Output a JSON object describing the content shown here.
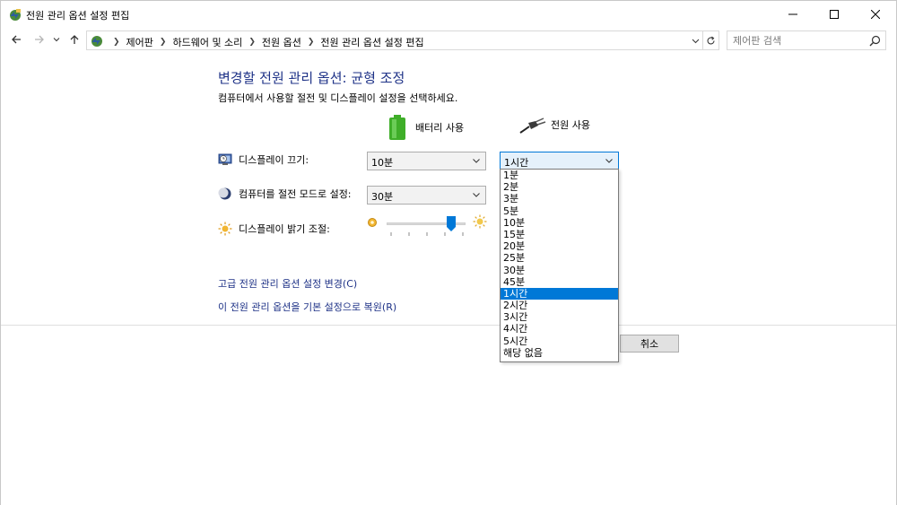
{
  "window": {
    "title": "전원 관리 옵션 설정 편집",
    "icon": "power-options-icon",
    "controls": [
      "minimize-icon",
      "maximize-icon",
      "close-icon"
    ]
  },
  "navigation": {
    "back": "back-arrow-icon",
    "forward": "forward-arrow-icon",
    "recent": "chevron-down-icon",
    "up": "up-arrow-icon",
    "breadcrumbs": [
      "제어판",
      "하드웨어 및 소리",
      "전원 옵션",
      "전원 관리 옵션 설정 편집"
    ],
    "refresh": "refresh-icon"
  },
  "search": {
    "placeholder": "제어판 검색",
    "icon": "search-icon"
  },
  "content": {
    "heading": "변경할 전원 관리 옵션: 균형 조정",
    "subheading": "컴퓨터에서 사용할 절전 및 디스플레이 설정을 선택하세요.",
    "columns": {
      "battery": "배터리 사용",
      "plugged": "전원 사용"
    },
    "settings": [
      {
        "label": "디스플레이 끄기:",
        "icon": "monitor-clock-icon",
        "battery_value": "10분",
        "plugged_value": "1시간"
      },
      {
        "label": "컴퓨터를 절전 모드로 설정:",
        "icon": "moon-sleep-icon",
        "battery_value": "30분"
      },
      {
        "label": "디스플레이 밝기 조절:",
        "icon": "sun-brightness-icon",
        "battery_brightness_fraction": 0.82
      }
    ],
    "links": {
      "advanced": "고급 전원 관리 옵션 설정 변경(C)",
      "restore": "이 전원 관리 옵션을 기본 설정으로 복원(R)"
    },
    "buttons": {
      "cancel": "취소"
    }
  },
  "dropdown": {
    "options": [
      "1분",
      "2분",
      "3분",
      "5분",
      "10분",
      "15분",
      "20분",
      "25분",
      "30분",
      "45분",
      "1시간",
      "2시간",
      "3시간",
      "4시간",
      "5시간",
      "해당 없음"
    ],
    "selected": "1시간"
  },
  "colors": {
    "heading": "#1e3287",
    "link": "#1e3287",
    "selection": "#0078d7",
    "battery": "#3fae29"
  }
}
